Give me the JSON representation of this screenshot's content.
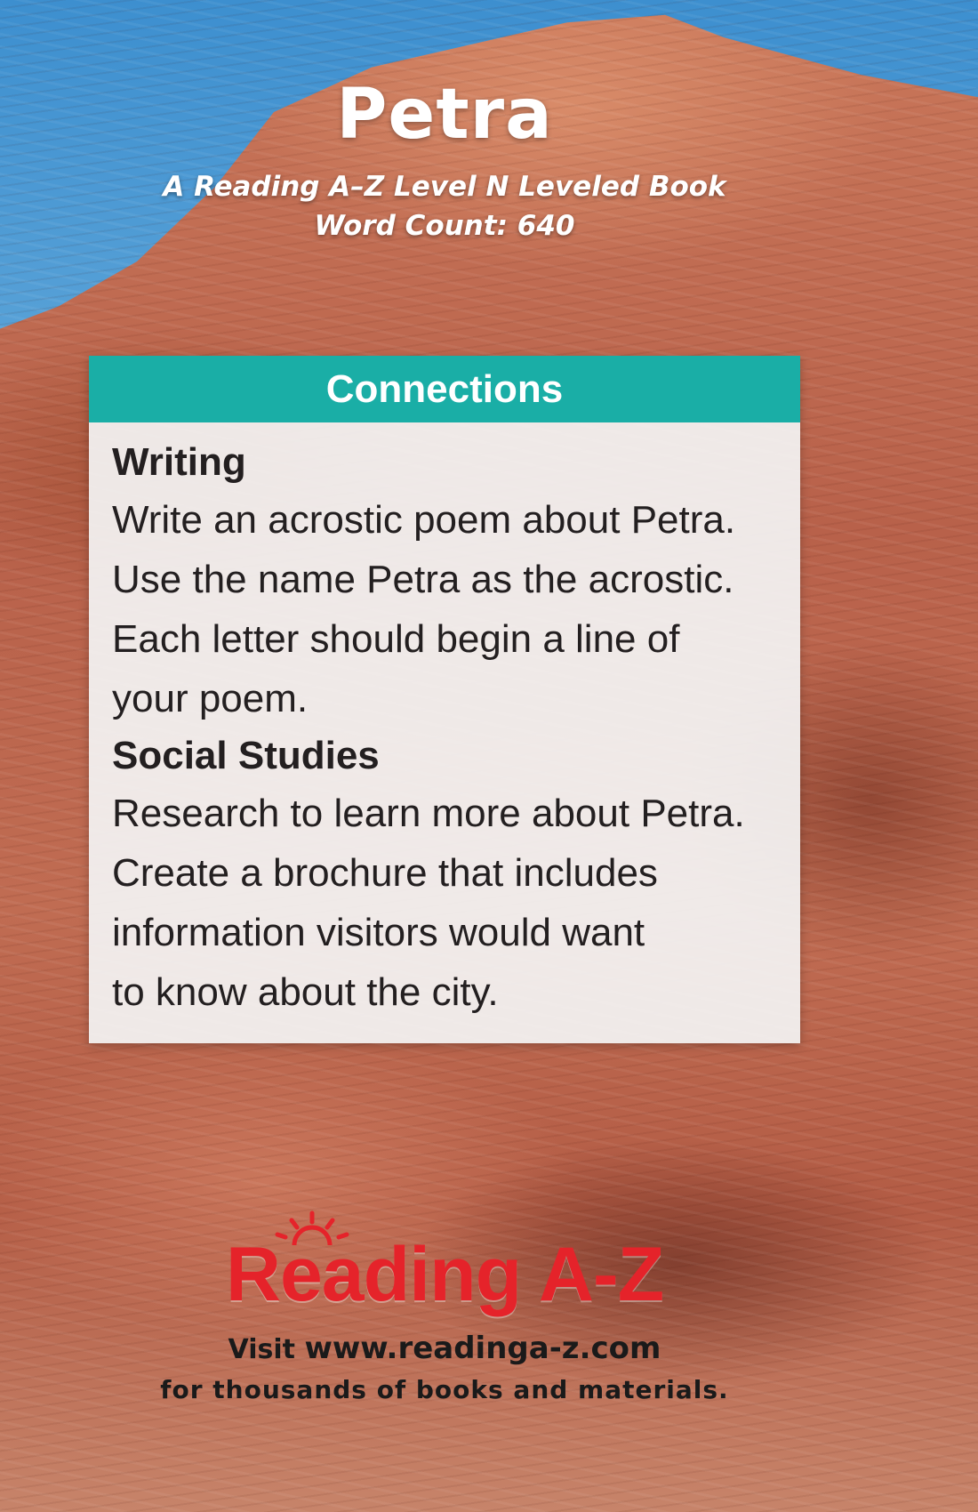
{
  "book": {
    "title": "Petra",
    "subtitle": "A Reading A–Z Level N Leveled Book",
    "word_count": "Word Count: 640"
  },
  "connections": {
    "heading": "Connections",
    "sections": [
      {
        "heading": "Writing",
        "lines": [
          "Write an acrostic poem about Petra.",
          "Use the name Petra as the acrostic.",
          "Each letter should begin a line of",
          "your poem."
        ]
      },
      {
        "heading": "Social Studies",
        "lines": [
          "Research to learn more about Petra.",
          "Create a brochure that includes",
          "information visitors would want",
          "to know about the city."
        ]
      }
    ]
  },
  "footer": {
    "logo_text": "Reading A-Z",
    "visit_prefix": "Visit",
    "url": "www.readinga-z.com",
    "tagline": "for thousands of books and materials."
  },
  "colors": {
    "header_bar": "#1aaea6",
    "logo_red": "#e5232a",
    "sky": "#3d8fcf",
    "rock": "#b8614a"
  }
}
